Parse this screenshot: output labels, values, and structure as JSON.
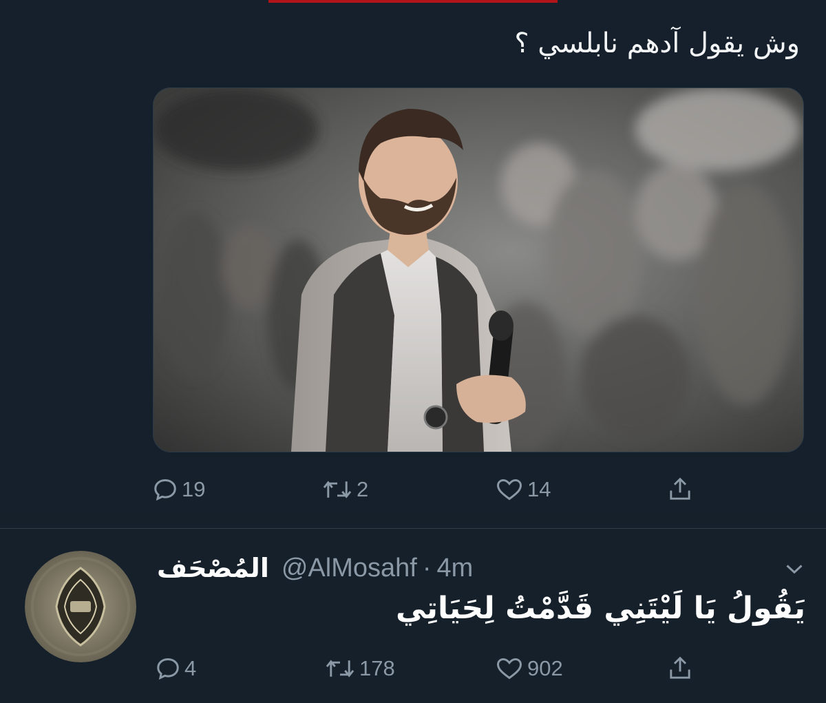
{
  "colors": {
    "background": "#15202b",
    "text_primary": "#ffffff",
    "text_secondary": "#8b98a5",
    "divider": "#2f3d4a"
  },
  "tweet1": {
    "text": "وش يقول آدهم نابلسي ؟",
    "media_icon": "photo-man-with-microphone",
    "actions": {
      "reply": {
        "icon": "reply-icon",
        "count": "19"
      },
      "retweet": {
        "icon": "retweet-icon",
        "count": "2"
      },
      "like": {
        "icon": "heart-icon",
        "count": "14"
      },
      "share": {
        "icon": "share-icon"
      }
    }
  },
  "tweet2": {
    "display_name": "المُصْحَف",
    "handle": "@AlMosahf",
    "separator": "·",
    "time": "4m",
    "avatar_icon": "quran-cover-icon",
    "menu_icon": "chevron-down-icon",
    "text": "يَقُولُ يَا لَيْتَنِي قَدَّمْتُ لِحَيَاتِي",
    "actions": {
      "reply": {
        "icon": "reply-icon",
        "count": "4"
      },
      "retweet": {
        "icon": "retweet-icon",
        "count": "178"
      },
      "like": {
        "icon": "heart-icon",
        "count": "902"
      },
      "share": {
        "icon": "share-icon"
      }
    }
  }
}
